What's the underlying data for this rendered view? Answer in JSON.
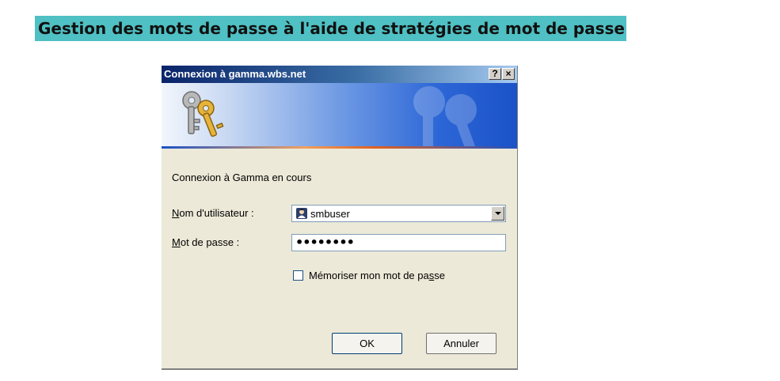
{
  "page_title": "Gestion des mots de passe à l'aide de stratégies de mot de passe",
  "dialog": {
    "title": "Connexion à gamma.wbs.net",
    "help_label": "?",
    "close_label": "×",
    "message": "Connexion à Gamma en cours",
    "username": {
      "label_prefix": "",
      "label_accel": "N",
      "label_rest": "om d'utilisateur :",
      "value": "smbuser",
      "icon": "user-icon"
    },
    "password": {
      "label_accel": "M",
      "label_rest": "ot de passe :",
      "value": "••••••••"
    },
    "remember": {
      "label_before": "Mémoriser mon mot de pa",
      "label_accel": "s",
      "label_after": "se",
      "checked": false
    },
    "ok_label": "OK",
    "cancel_label": "Annuler"
  },
  "colors": {
    "title_highlight": "#4fc0c3",
    "titlebar_start": "#0a246a",
    "dialog_bg": "#ece9d8"
  }
}
